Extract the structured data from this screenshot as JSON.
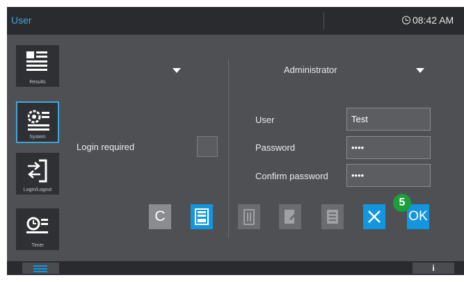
{
  "header": {
    "title": "User",
    "time": "08:42 AM"
  },
  "sidebar": {
    "items": [
      {
        "label": "Results",
        "active": false
      },
      {
        "label": "System",
        "active": true
      },
      {
        "label": "Login/Logout",
        "active": false
      },
      {
        "label": "Timer",
        "active": false
      }
    ]
  },
  "left_panel": {
    "login_required_label": "Login required",
    "login_required_checked": false
  },
  "right_panel": {
    "role_value": "Administrator",
    "user_label": "User",
    "user_value": "Test",
    "password_label": "Password",
    "password_value": "••••",
    "confirm_label": "Confirm password",
    "confirm_value": "••••"
  },
  "toolbar": {
    "cancel_label": "C",
    "ok_label": "OK",
    "step_badge": "5"
  },
  "footer": {
    "info_label": "i"
  },
  "colors": {
    "accent": "#1496de",
    "title": "#3ea6dc",
    "badge": "#1c9e3a"
  }
}
